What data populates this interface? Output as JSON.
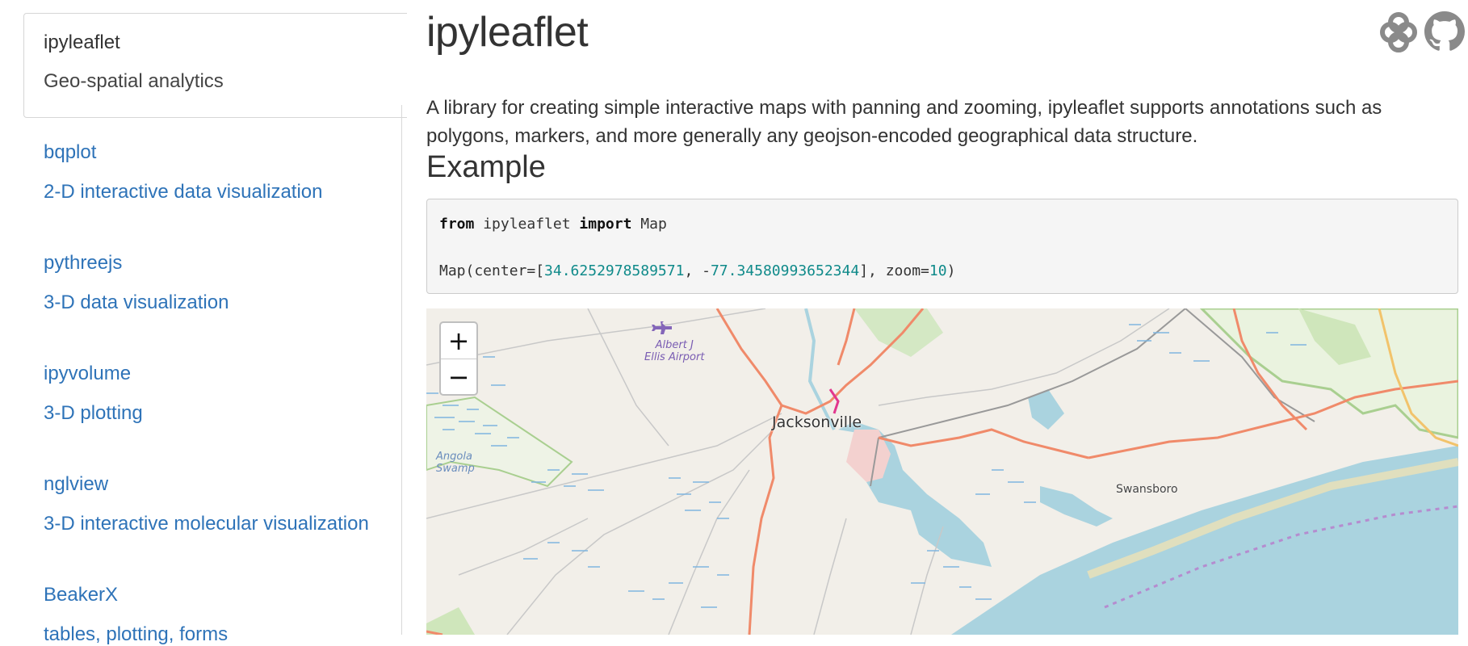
{
  "sidebar": {
    "active": {
      "name": "ipyleaflet",
      "description": "Geo-spatial analytics"
    },
    "items": [
      {
        "name": "bqplot",
        "description": "2-D interactive data visualization"
      },
      {
        "name": "pythreejs",
        "description": "3-D data visualization"
      },
      {
        "name": "ipyvolume",
        "description": "3-D plotting"
      },
      {
        "name": "nglview",
        "description": "3-D interactive molecular visualization"
      },
      {
        "name": "BeakerX",
        "description": "tables, plotting, forms"
      }
    ]
  },
  "main": {
    "title": "ipyleaflet",
    "intro": "A library for creating simple interactive maps with panning and zooming, ipyleaflet supports annotations such as polygons, markers, and more generally any geojson-encoded geographical data structure.",
    "example_heading": "Example",
    "code": {
      "kw_from": "from",
      "module": " ipyleaflet ",
      "kw_import": "import",
      "name": " Map",
      "call_prefix": "Map(center=[",
      "lat": "34.6252978589571",
      "sep": ", -",
      "lon": "77.34580993652344",
      "mid": "], zoom=",
      "zoom": "10",
      "end": ")"
    },
    "icons": [
      "binder-icon",
      "github-icon"
    ]
  },
  "map": {
    "zoom_in": "+",
    "zoom_out": "−",
    "labels": {
      "airport_line1": "Albert J",
      "airport_line2": "Ellis Airport",
      "city": "Jacksonville",
      "town": "Swansboro",
      "swamp_line1": "Angola",
      "swamp_line2": "Swamp"
    },
    "colors": {
      "land": "#f2efe9",
      "water": "#aad3df",
      "road_major": "#f08a6a",
      "road_minor": "#c8c8c8",
      "park": "#c8e6b4",
      "urban": "#f3d1cf",
      "link": "#2e73b8"
    }
  }
}
